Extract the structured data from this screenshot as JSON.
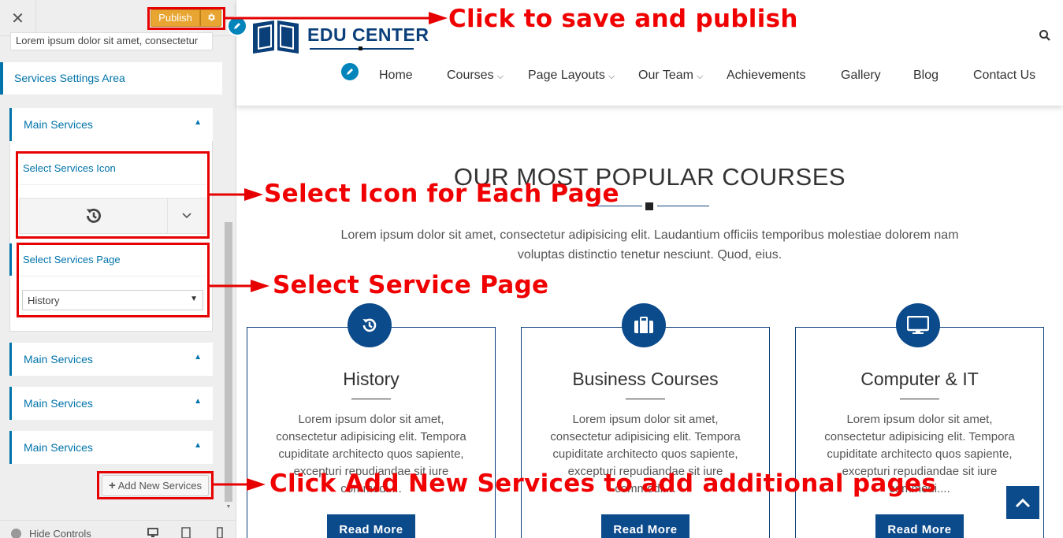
{
  "sidebar": {
    "close_label": "✕",
    "publish_label": "Publish",
    "text_field_value": "Lorem ipsum dolor sit amet, consectetur",
    "section_title": "Services Settings Area",
    "accordion_label": "Main Services",
    "field_icon_label": "Select Services Icon",
    "field_page_label": "Select Services Page",
    "page_select_value": "History",
    "add_new_label": "Add New Services",
    "hide_controls_label": "Hide Controls"
  },
  "site": {
    "logo_text": "EDU CENTER",
    "nav": [
      {
        "label": "Home"
      },
      {
        "label": "Courses"
      },
      {
        "label": "Page Layouts"
      },
      {
        "label": "Our Team"
      },
      {
        "label": "Achievements"
      },
      {
        "label": "Gallery"
      },
      {
        "label": "Blog"
      },
      {
        "label": "Contact Us"
      }
    ],
    "section_title": "OUR MOST POPULAR COURSES",
    "section_subtitle": "Lorem ipsum dolor sit amet, consectetur adipisicing elit. Laudantium officiis temporibus molestiae dolorem nam voluptas distinctio tenetur nesciunt. Quod, eius.",
    "cards": [
      {
        "title": "History",
        "icon": "history-icon",
        "text": "Lorem ipsum dolor sit amet, consectetur adipisicing elit. Tempora cupiditate architecto quos sapiente, excepturi repudiandae sit iure commodi....",
        "button": "Read More"
      },
      {
        "title": "Business Courses",
        "icon": "briefcase-icon",
        "text": "Lorem ipsum dolor sit amet, consectetur adipisicing elit. Tempora cupiditate architecto quos sapiente, excepturi repudiandae sit iure commodi....",
        "button": "Read More"
      },
      {
        "title": "Computer & IT",
        "icon": "desktop-icon",
        "text": "Lorem ipsum dolor sit amet, consectetur adipisicing elit. Tempora cupiditate architecto quos sapiente, excepturi repudiandae sit iure commodi....",
        "button": "Read More"
      }
    ]
  },
  "annotations": {
    "publish": "Click to save and publish",
    "icon": "Select Icon for Each Page",
    "page": "Select Service Page",
    "add_new": "Click Add New Services to add additional pages"
  },
  "colors": {
    "accent": "#0073aa",
    "brand": "#0b4a8b",
    "publish": "#e8a531",
    "annotation": "#e60000"
  }
}
